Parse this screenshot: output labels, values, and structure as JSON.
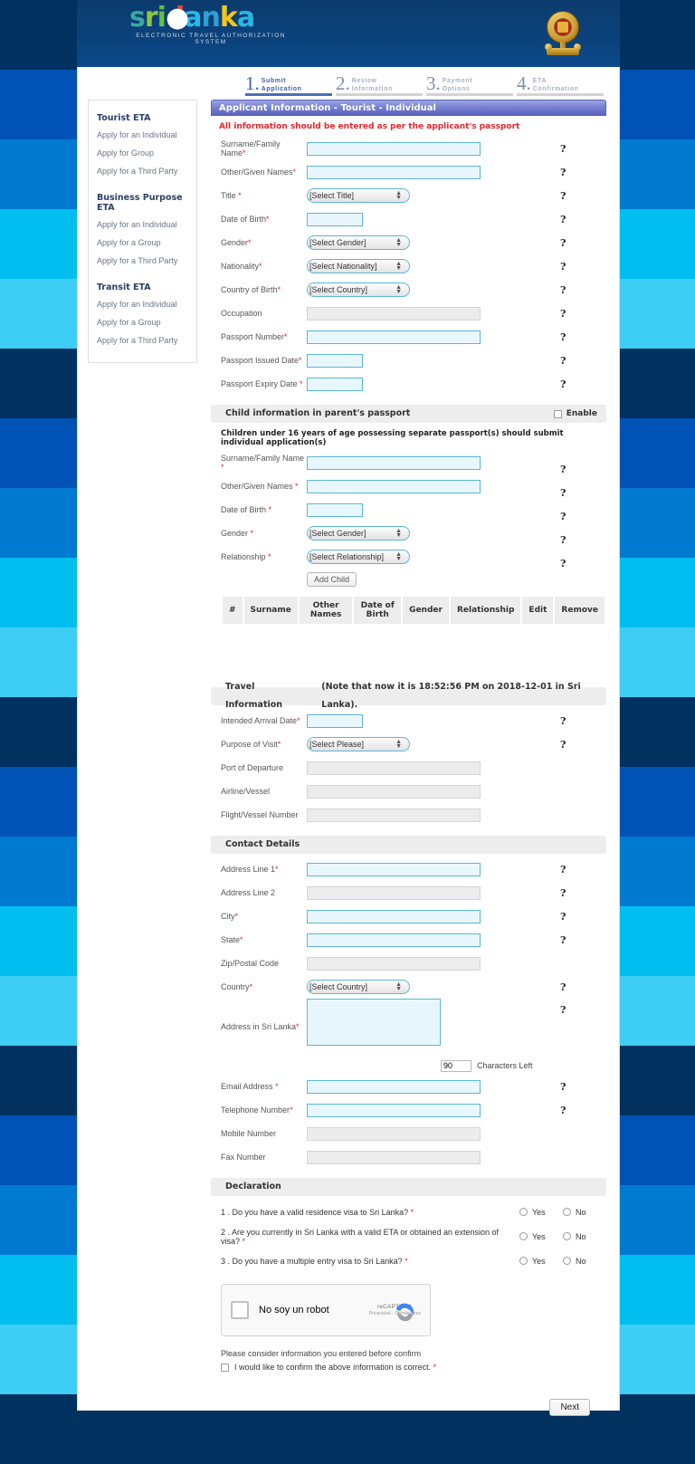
{
  "header": {
    "logo": {
      "parts": [
        "sri",
        "lanka"
      ],
      "tagline": "ELECTRONIC TRAVEL AUTHORIZATION SYSTEM"
    },
    "emblem_alt": "sri-lanka-emblem"
  },
  "steps": [
    {
      "num": "1",
      "line1": "Submit",
      "line2": "Application",
      "active": true
    },
    {
      "num": "2",
      "line1": "Review",
      "line2": "Information",
      "active": false
    },
    {
      "num": "3",
      "line1": "Payment",
      "line2": "Options",
      "active": false
    },
    {
      "num": "4",
      "line1": "ETA",
      "line2": "Confirmation",
      "active": false
    }
  ],
  "sidebar": {
    "groups": [
      {
        "heading": "Tourist ETA",
        "links": [
          "Apply for an Individual",
          "Apply for Group",
          "Apply for a Third Party"
        ]
      },
      {
        "heading": "Business Purpose ETA",
        "links": [
          "Apply for an Individual",
          "Apply for a Group",
          "Apply for a Third Party"
        ]
      },
      {
        "heading": "Transit ETA",
        "links": [
          "Apply for an Individual",
          "Apply for a Group",
          "Apply for a Third Party"
        ]
      }
    ]
  },
  "form": {
    "panel_title": "Applicant Information - Tourist - Individual",
    "warning": "All information should be entered as per the applicant's passport",
    "help_glyph": "?",
    "applicant": {
      "surname_label": "Surname/Family Name",
      "other_names_label": "Other/Given Names",
      "title_label": "Title ",
      "title_value": "[Select Title]",
      "dob_label": "Date of Birth",
      "gender_label": "Gender",
      "gender_value": "[Select Gender]",
      "nationality_label": "Nationality",
      "nationality_value": "[Select Nationality]",
      "country_of_birth_label": "Country of Birth",
      "country_of_birth_value": "[Select Country]",
      "occupation_label": "Occupation",
      "passport_number_label": "Passport Number",
      "passport_issued_label": "Passport Issued Date",
      "passport_expiry_label": "Passport Expiry Date "
    },
    "child": {
      "section_title": "Child information in parent's passport",
      "enable_label": "Enable",
      "note": "Children under 16 years of age possessing separate passport(s) should submit individual application(s)",
      "surname_label": "Surname/Family Name ",
      "other_names_label": "Other/Given Names ",
      "dob_label": "Date of Birth ",
      "gender_label": "Gender ",
      "gender_value": "[Select Gender]",
      "relationship_label": "Relationship ",
      "relationship_value": "[Select Relationship]",
      "add_button": "Add Child",
      "table_headers": [
        "#",
        "Surname",
        "Other Names",
        "Date of Birth",
        "Gender",
        "Relationship",
        "Edit",
        "Remove"
      ],
      "rows": []
    },
    "travel": {
      "section_title": "Travel Information",
      "section_note": "(Note that now it is 18:52:56 PM on 2018-12-01 in Sri Lanka).",
      "arrival_label": "Intended Arrival Date",
      "purpose_label": "Purpose of Visit",
      "purpose_value": "[Select Please]",
      "port_label": "Port of Departure",
      "airline_label": "Airline/Vessel",
      "flight_label": "Flight/Vessel Number"
    },
    "contact": {
      "section_title": "Contact Details",
      "address1_label": "Address Line 1",
      "address2_label": "Address Line 2",
      "city_label": "City",
      "state_label": "State",
      "zip_label": "Zip/Postal Code",
      "country_label": "Country",
      "country_value": "[Select Country]",
      "sl_address_label": "Address in Sri Lanka",
      "chars_value": "90",
      "chars_suffix": "Characters Left",
      "email_label": "Email Address ",
      "telephone_label": "Telephone Number",
      "mobile_label": "Mobile Number",
      "fax_label": "Fax Number"
    },
    "declaration": {
      "section_title": "Declaration",
      "yes_label": "Yes",
      "no_label": "No",
      "questions": [
        "1 . Do you have a valid residence visa to Sri Lanka? ",
        "2 . Are you currently in Sri Lanka with a valid ETA or obtained an extension of visa? ",
        "3 . Do you have a multiple entry visa to Sri Lanka? "
      ]
    },
    "captcha": {
      "checkbox_label": "No soy un robot",
      "brand": "reCAPTCHA",
      "legal": "Privacidad - Condiciones"
    },
    "footer": {
      "consider_text": "Please consider information you entered before confirm",
      "confirm_text": "I would like to confirm the above information is correct. ",
      "next_label": "Next"
    }
  },
  "colors": {
    "accent_panel": "#5a63bd",
    "warning_red": "#e8262b",
    "field_blue": "#e8f7fd",
    "field_border": "#5bb6d6",
    "banner_navy": "#0c3c6e",
    "stripe_navy": "#00315f",
    "stripe_blue": "#0052b4",
    "stripe_mid": "#0079d0",
    "stripe_cyan": "#00bff0",
    "stripe_light": "#3ecdf5"
  }
}
